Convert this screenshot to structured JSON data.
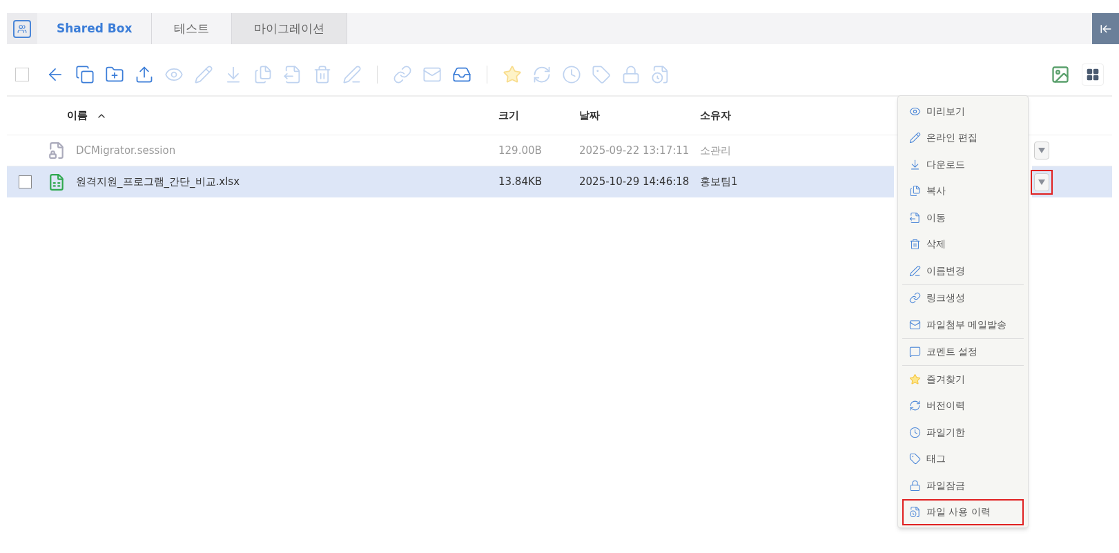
{
  "breadcrumb": [
    {
      "label": "Shared Box",
      "kind": "root"
    },
    {
      "label": "테스트",
      "kind": "folder"
    },
    {
      "label": "마이그레이션",
      "kind": "current"
    }
  ],
  "select_all": {
    "checked": false
  },
  "toolbar_groups": [
    {
      "items": [
        {
          "kind": "back",
          "disabled": false
        },
        {
          "kind": "copy-box",
          "disabled": false
        },
        {
          "kind": "new-folder",
          "disabled": false
        },
        {
          "kind": "upload",
          "disabled": false
        },
        {
          "kind": "eye",
          "disabled": true
        },
        {
          "kind": "pencil",
          "disabled": true
        },
        {
          "kind": "download",
          "disabled": true
        },
        {
          "kind": "copy",
          "disabled": true
        },
        {
          "kind": "move",
          "disabled": true
        },
        {
          "kind": "trash",
          "disabled": true
        },
        {
          "kind": "rename",
          "disabled": true
        }
      ]
    },
    {
      "items": [
        {
          "kind": "link",
          "disabled": true
        },
        {
          "kind": "mail",
          "disabled": true
        },
        {
          "kind": "inbox",
          "disabled": false
        }
      ]
    },
    {
      "items": [
        {
          "kind": "star",
          "disabled": true
        },
        {
          "kind": "version",
          "disabled": true
        },
        {
          "kind": "clock",
          "disabled": true
        },
        {
          "kind": "tag",
          "disabled": true
        },
        {
          "kind": "lock",
          "disabled": true
        },
        {
          "kind": "history",
          "disabled": true
        }
      ]
    }
  ],
  "columns": [
    {
      "label": "이름",
      "sorted": true
    },
    {
      "label": "크기",
      "sorted": false
    },
    {
      "label": "날짜",
      "sorted": false
    },
    {
      "label": "소유자",
      "sorted": false
    }
  ],
  "rows": [
    {
      "name": "DCMigrator.session",
      "size": "129.00B",
      "date": "2025-09-22 13:17:11",
      "owner": "소관리",
      "kind": "locked",
      "selected": false,
      "dimmed": true,
      "highlighted": false
    },
    {
      "name": "원격지원_프로그램_간단_비교.xlsx",
      "size": "13.84KB",
      "date": "2025-10-29 14:46:18",
      "owner": "홍보팀1",
      "kind": "sheet",
      "selected": true,
      "dimmed": false,
      "highlighted": true
    }
  ],
  "menu_groups": [
    {
      "items": [
        {
          "label": "미리보기",
          "kind": "eye",
          "highlighted": false
        },
        {
          "label": "온라인 편집",
          "kind": "pencil",
          "highlighted": false
        },
        {
          "label": "다운로드",
          "kind": "download",
          "highlighted": false
        },
        {
          "label": "복사",
          "kind": "copy",
          "highlighted": false
        },
        {
          "label": "이동",
          "kind": "move",
          "highlighted": false
        },
        {
          "label": "삭제",
          "kind": "trash",
          "highlighted": false
        },
        {
          "label": "이름변경",
          "kind": "rename",
          "highlighted": false
        }
      ]
    },
    {
      "items": [
        {
          "label": "링크생성",
          "kind": "link",
          "highlighted": false
        },
        {
          "label": "파일첨부 메일발송",
          "kind": "mail",
          "highlighted": false
        }
      ]
    },
    {
      "items": [
        {
          "label": "코멘트 설정",
          "kind": "comment",
          "highlighted": false
        }
      ]
    },
    {
      "items": [
        {
          "label": "즐겨찾기",
          "kind": "star",
          "highlighted": false
        },
        {
          "label": "버전이력",
          "kind": "version",
          "highlighted": false
        },
        {
          "label": "파일기한",
          "kind": "clock",
          "highlighted": false
        },
        {
          "label": "태그",
          "kind": "tag",
          "highlighted": false
        },
        {
          "label": "파일잠금",
          "kind": "lock",
          "highlighted": false
        },
        {
          "label": "파일 사용 이력",
          "kind": "history",
          "highlighted": true
        }
      ]
    }
  ]
}
